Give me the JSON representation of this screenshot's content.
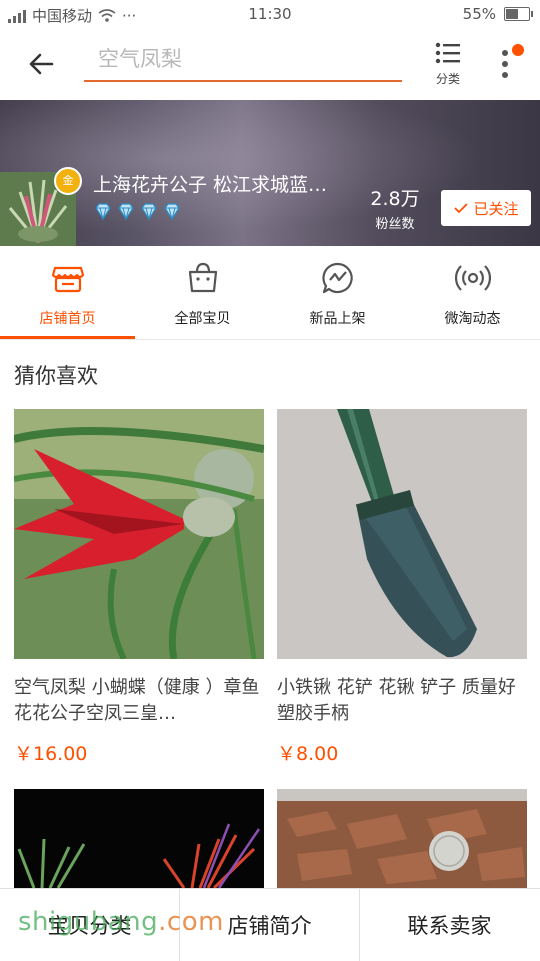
{
  "status_bar": {
    "carrier": "中国移动",
    "extra": "···",
    "time": "11:30",
    "battery": "55%",
    "battery_level": 0.55
  },
  "top_bar": {
    "search_placeholder": "空气凤梨",
    "category_label": "分类"
  },
  "shop": {
    "name": "上海花卉公子 松江求城蓝…",
    "fans_count": "2.8万",
    "fans_label": "粉丝数",
    "follow_label": "已关注",
    "crown_glyph": "金",
    "diamond_count": 4
  },
  "tabs": [
    {
      "label": "店铺首页",
      "icon": "shop-icon",
      "active": true
    },
    {
      "label": "全部宝贝",
      "icon": "bag-icon",
      "active": false
    },
    {
      "label": "新品上架",
      "icon": "new-icon",
      "active": false
    },
    {
      "label": "微淘动态",
      "icon": "broadcast-icon",
      "active": false
    }
  ],
  "section": {
    "title": "猜你喜欢"
  },
  "products": [
    {
      "title": "空气凤梨 小蝴蝶（健康 ）章鱼 花花公子空凤三皇…",
      "price": "￥16.00"
    },
    {
      "title": "小铁锹 花铲 花锹 铲子 质量好 塑胶手柄",
      "price": "￥8.00"
    }
  ],
  "bottom_bar": {
    "items": [
      "宝贝分类",
      "店铺简介",
      "联系卖家"
    ]
  },
  "watermark": {
    "text_a": "shi",
    "text_b": "gu",
    "text_c": "bang",
    "text_d": ".com"
  },
  "colors": {
    "accent": "#ff5000",
    "search_underline": "#e36a2e"
  }
}
